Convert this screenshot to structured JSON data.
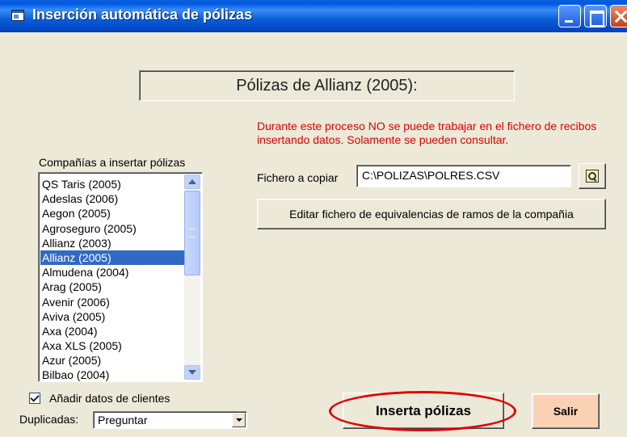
{
  "window": {
    "title": "Inserción automática de pólizas"
  },
  "header": {
    "title": "Pólizas de Allianz (2005):"
  },
  "warning": "Durante este proceso NO se puede trabajar en el fichero de recibos insertando datos. Solamente se pueden consultar.",
  "companies": {
    "label": "Compañías a insertar pólizas",
    "items": [
      "QS Taris (2005)",
      "Adeslas (2006)",
      "Aegon (2005)",
      "Agroseguro (2005)",
      "Allianz (2003)",
      "Allianz (2005)",
      "Almudena (2004)",
      "Arag (2005)",
      "Avenir (2006)",
      "Aviva (2005)",
      "Axa (2004)",
      "Axa XLS (2005)",
      "Azur (2005)",
      "Bilbao (2004)"
    ],
    "selected": "Allianz (2005)"
  },
  "file": {
    "label": "Fichero a copiar",
    "value": "C:\\POLIZAS\\POLRES.CSV"
  },
  "edit_button": "Editar fichero de equivalencias de ramos de la compañia",
  "add_clients": {
    "label": "Añadir datos de clientes",
    "checked": true
  },
  "duplicates": {
    "label": "Duplicadas:",
    "value": "Preguntar"
  },
  "insert_button": "Inserta pólizas",
  "exit_button": "Salir",
  "colors": {
    "warning": "#e00000",
    "selection": "#316ac5",
    "exit_button_bg": "#fbd1b4",
    "highlight": "#e00000"
  }
}
